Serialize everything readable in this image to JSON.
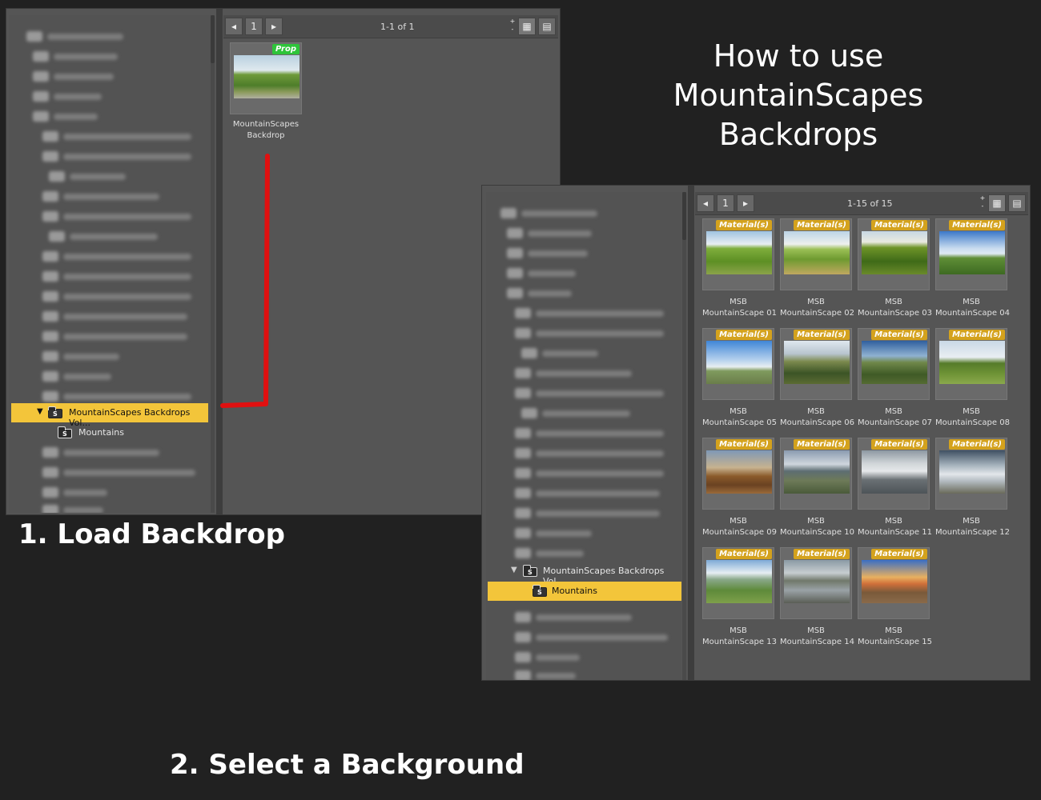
{
  "title": {
    "line1": "How to use",
    "line2": "MountainScapes",
    "line3": "Backdrops"
  },
  "steps": {
    "step1": "1. Load Backdrop",
    "step2": "2. Select a Background"
  },
  "panel1": {
    "nav": {
      "prev_icon": "arrow-left-icon",
      "page": "1",
      "next_icon": "arrow-right-icon",
      "page_info": "1-1 of 1"
    },
    "tree": {
      "selected": "MountainScapes Backdrops Vol...",
      "child": "Mountains"
    },
    "item": {
      "badge": "Prop",
      "line1": "MountainScapes",
      "line2": "Backdrop"
    },
    "connector_color": "#e01010"
  },
  "panel2": {
    "nav": {
      "page": "1",
      "page_info": "1-15 of 15"
    },
    "tree": {
      "parent": "MountainScapes Backdrops Vol...",
      "selected": "Mountains"
    },
    "items": [
      {
        "badge": "Material(s)",
        "line1": "MSB",
        "line2": "MountainScape 01"
      },
      {
        "badge": "Material(s)",
        "line1": "MSB",
        "line2": "MountainScape 02"
      },
      {
        "badge": "Material(s)",
        "line1": "MSB",
        "line2": "MountainScape 03"
      },
      {
        "badge": "Material(s)",
        "line1": "MSB",
        "line2": "MountainScape 04"
      },
      {
        "badge": "Material(s)",
        "line1": "MSB",
        "line2": "MountainScape 05"
      },
      {
        "badge": "Material(s)",
        "line1": "MSB",
        "line2": "MountainScape 06"
      },
      {
        "badge": "Material(s)",
        "line1": "MSB",
        "line2": "MountainScape 07"
      },
      {
        "badge": "Material(s)",
        "line1": "MSB",
        "line2": "MountainScape 08"
      },
      {
        "badge": "Material(s)",
        "line1": "MSB",
        "line2": "MountainScape 09"
      },
      {
        "badge": "Material(s)",
        "line1": "MSB",
        "line2": "MountainScape 10"
      },
      {
        "badge": "Material(s)",
        "line1": "MSB",
        "line2": "MountainScape 11"
      },
      {
        "badge": "Material(s)",
        "line1": "MSB",
        "line2": "MountainScape 12"
      },
      {
        "badge": "Material(s)",
        "line1": "MSB",
        "line2": "MountainScape 13"
      },
      {
        "badge": "Material(s)",
        "line1": "MSB",
        "line2": "MountainScape 14"
      },
      {
        "badge": "Material(s)",
        "line1": "MSB",
        "line2": "MountainScape 15"
      }
    ]
  },
  "colors": {
    "selection": "#f3c53a",
    "prop_badge": "#2ec43a",
    "material_badge": "#d4a21d",
    "background": "#212121"
  }
}
